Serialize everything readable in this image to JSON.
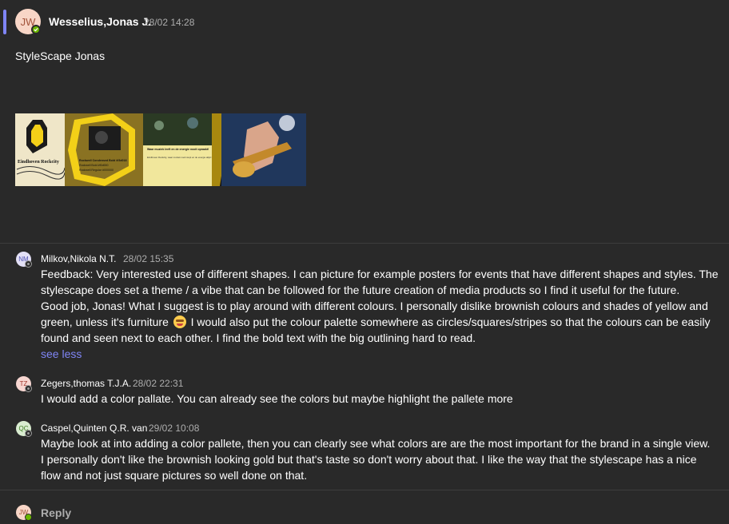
{
  "post": {
    "avatar_initials": "JW",
    "author": "Wesselius,Jonas J.",
    "time": "28/02 14:28",
    "body": "StyleScape Jonas",
    "image": {
      "brand_text": "Eindhoven Rockcity",
      "font_sample_title": "Rockwell Condensed Bold #f3d018",
      "font_sample_line2": "Rockwell Bold #f0d000",
      "font_sample_line3": "Rockwell Regular #000000",
      "panel_heading": "Waar muziek leeft en de energie nooit opraakt!",
      "panel_text": "Eindhoven Rockcity, waar muziek nooit stopt en de energie altijd voelbaar is."
    }
  },
  "replies": [
    {
      "initials": "NM",
      "avatar_color": "#e3e0f6",
      "avatar_text_color": "#4f52b2",
      "author": "Milkov,Nikola N.T.",
      "time": "28/02 15:35",
      "text_lines": [
        "Feedback: Very interested use of different shapes. I can picture for example posters for events that have different shapes and styles. The",
        "stylescape does set a theme / a vibe that can be followed for the future creation of media products so I find it useful for the future.",
        "Good job, Jonas! What I suggest is to play around with different colours. I personally dislike brownish colours and shades of yellow and",
        "green, unless it's furniture",
        " I would also put the colour palette somewhere as circles/squares/stripes so that the colours can be easily",
        "found and seen next to each other. I find the bold text with the big outlining hard to read."
      ],
      "see_less": "see less"
    },
    {
      "initials": "TZ",
      "avatar_color": "#f7d6d1",
      "avatar_text_color": "#a0352b",
      "author": "Zegers,thomas T.J.A.",
      "time": "28/02 22:31",
      "text_lines": [
        "I would add a color pallate. You can already see the colors but maybe highlight the pallete more"
      ]
    },
    {
      "initials": "QC",
      "avatar_color": "#d9ecd0",
      "avatar_text_color": "#3b7a1f",
      "author": "Caspel,Quinten Q.R. van",
      "time": "29/02 10:08",
      "text_lines": [
        "Maybe look at into adding a color pallete, then you can clearly see what colors are are the most important for the brand in a single view.",
        "I personally don't like the brownish looking gold but that's taste so don't worry about that. I like the way that the stylescape has a nice",
        "flow and not just square pictures so well done on that."
      ]
    }
  ],
  "reply_bar": {
    "avatar_initials": "JW",
    "label": "Reply"
  },
  "colors": {
    "background": "#292929",
    "accent": "#7f85f5",
    "presence_available": "#6bb700",
    "brand_yellow": "#f3d018"
  }
}
